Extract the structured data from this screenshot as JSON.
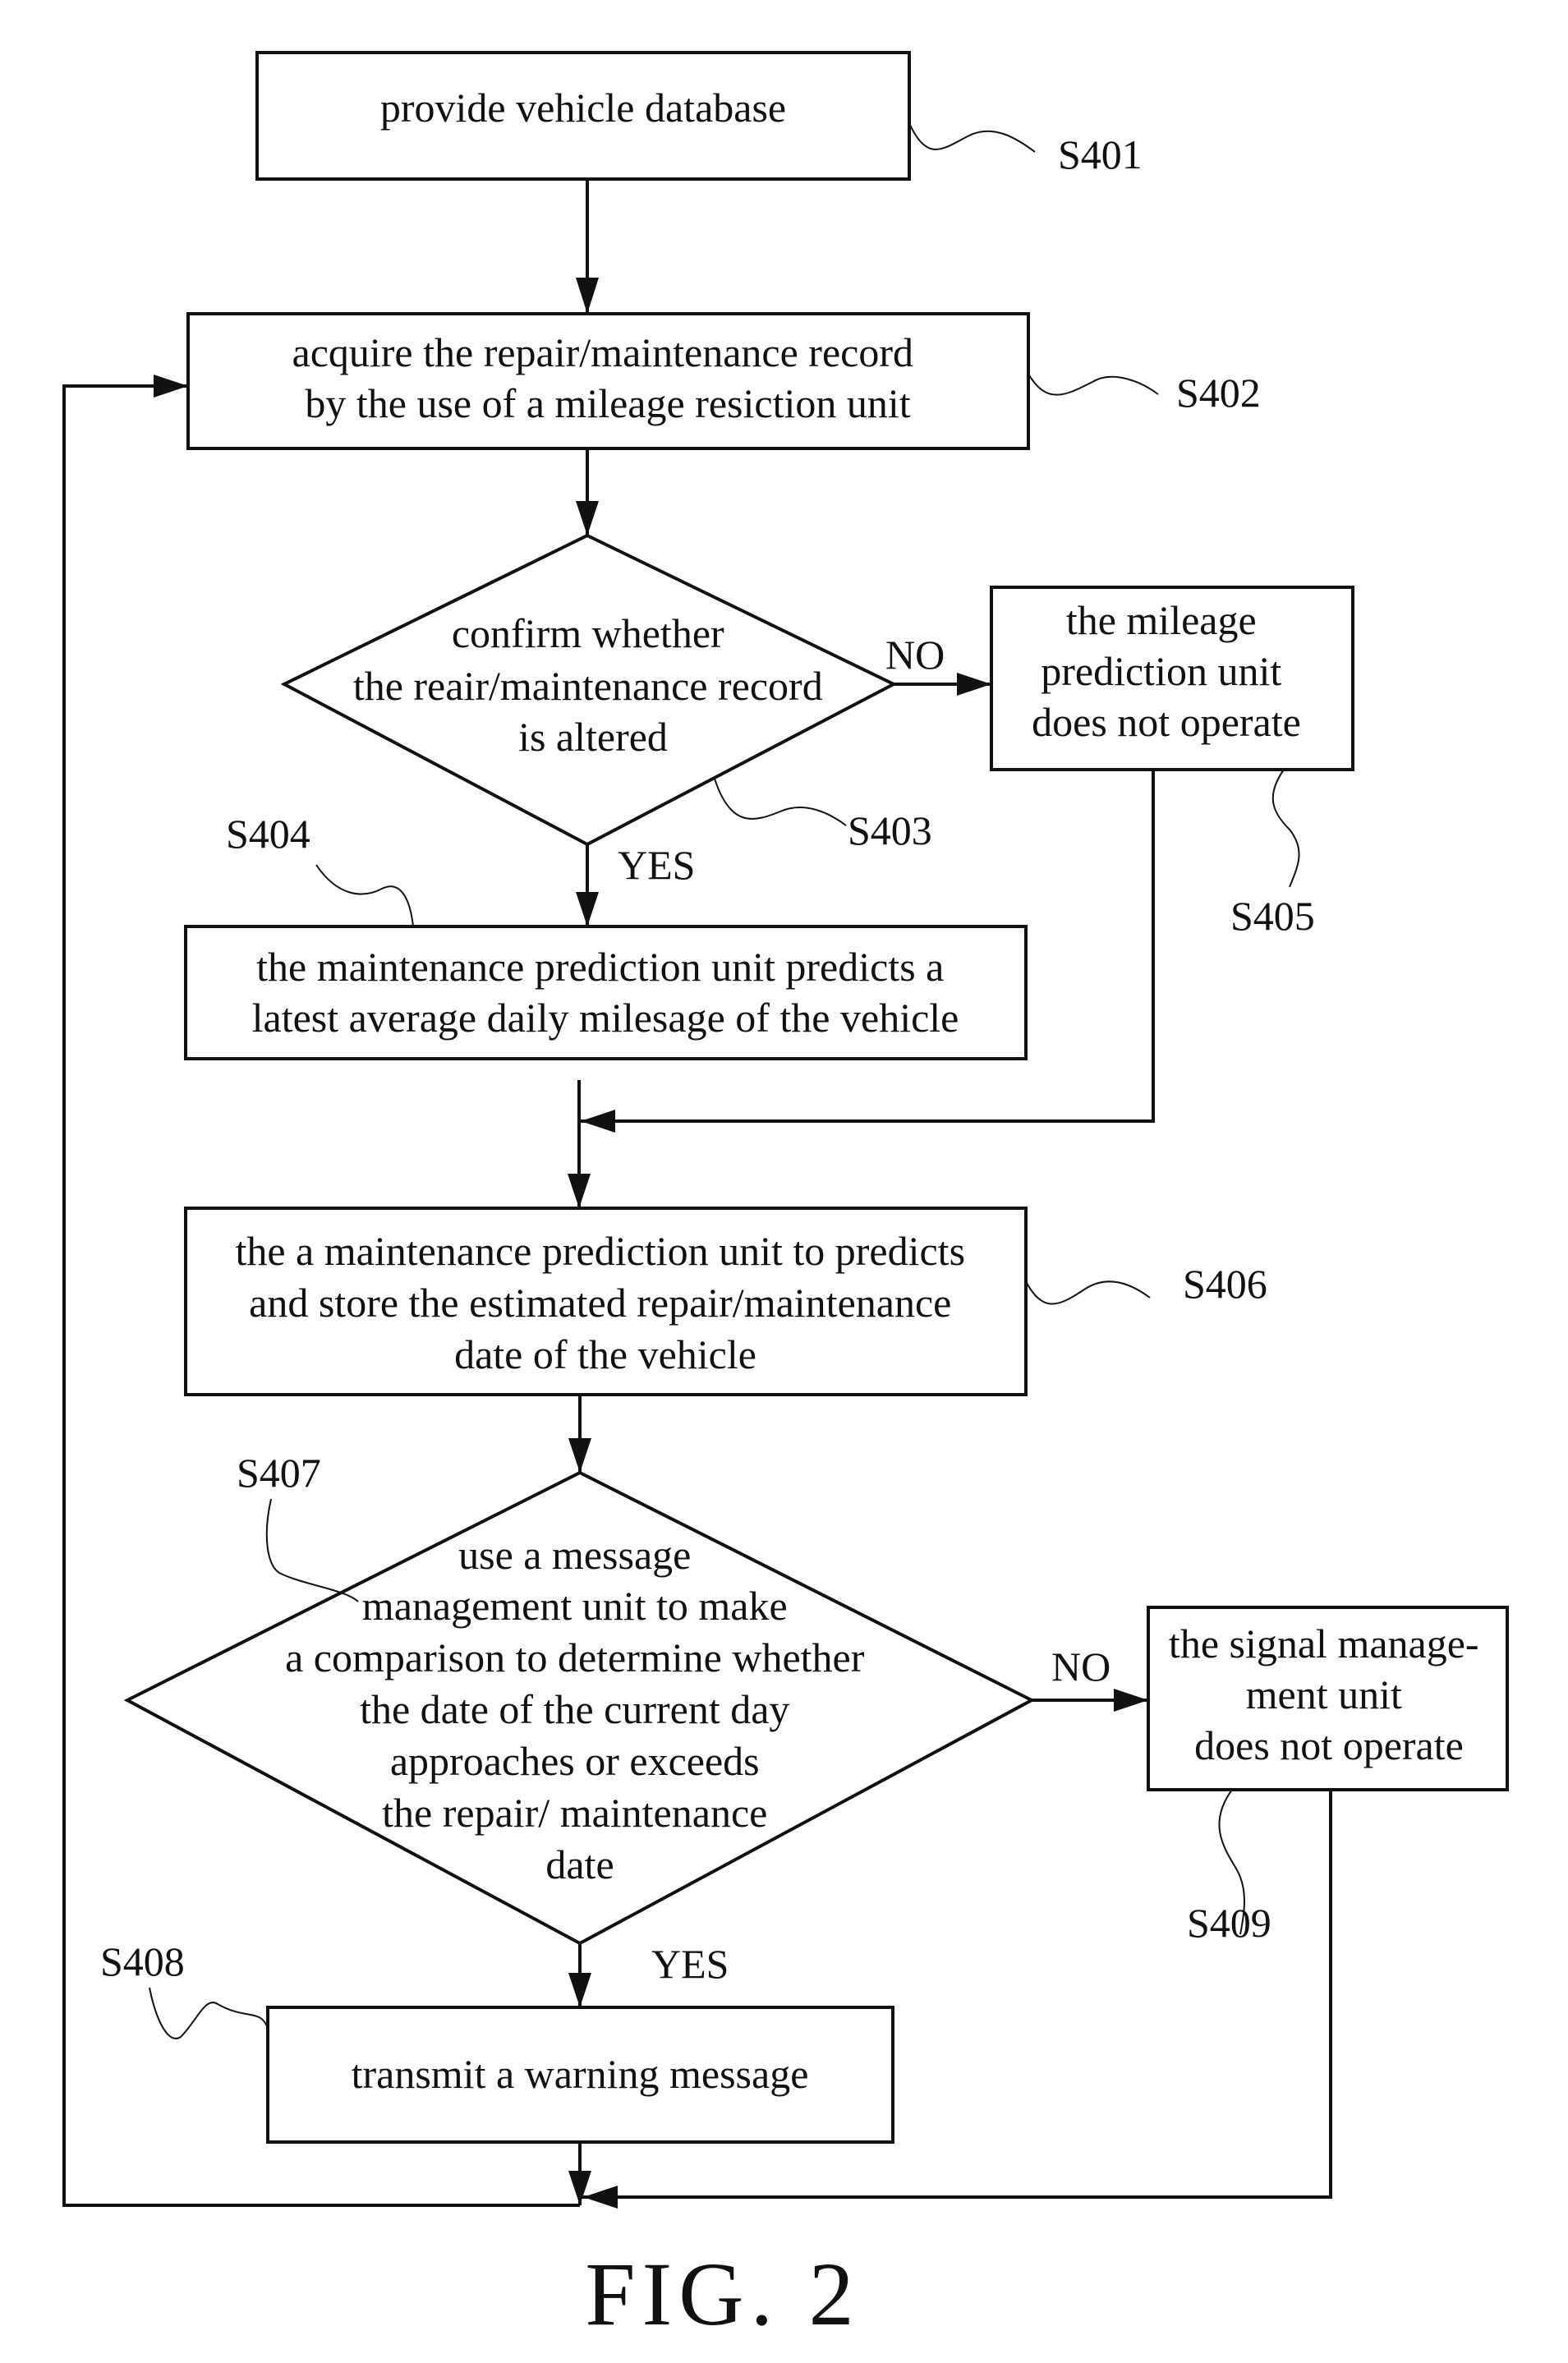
{
  "figure_label": "FIG. 2",
  "steps": {
    "s401": {
      "id": "S401",
      "type": "process",
      "lines": [
        "provide vehicle database"
      ]
    },
    "s402": {
      "id": "S402",
      "type": "process",
      "lines": [
        "acquire the repair/maintenance record",
        "by the use of a mileage resiction unit"
      ]
    },
    "s403": {
      "id": "S403",
      "type": "decision",
      "lines": [
        "confirm whether",
        "the reair/maintenance record",
        "is altered"
      ]
    },
    "s404": {
      "id": "S404",
      "type": "process",
      "lines": [
        "the maintenance prediction unit predicts a",
        "latest average daily milesage of the vehicle"
      ]
    },
    "s405": {
      "id": "S405",
      "type": "process",
      "lines": [
        "the mileage",
        "prediction unit",
        "does not operate"
      ]
    },
    "s406": {
      "id": "S406",
      "type": "process",
      "lines": [
        "the a maintenance prediction unit to predicts",
        "and store the estimated repair/maintenance",
        "date of the vehicle"
      ]
    },
    "s407": {
      "id": "S407",
      "type": "decision",
      "lines": [
        "use a message",
        "management unit to make",
        "a comparison to determine whether",
        "the date of the current day",
        "approaches or exceeds",
        "the repair/ maintenance",
        "date"
      ]
    },
    "s408": {
      "id": "S408",
      "type": "process",
      "lines": [
        "transmit a warning message"
      ]
    },
    "s409": {
      "id": "S409",
      "type": "process",
      "lines": [
        "the signal manage-",
        "ment unit",
        "does not operate"
      ]
    }
  },
  "branch_labels": {
    "s403_no": "NO",
    "s403_yes": "YES",
    "s407_no": "NO",
    "s407_yes": "YES"
  },
  "colors": {
    "ink": "#111111",
    "background": "#ffffff"
  }
}
